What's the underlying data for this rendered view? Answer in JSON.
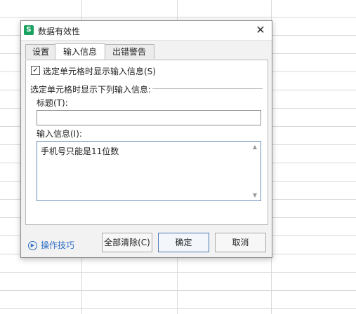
{
  "dialog": {
    "title": "数据有效性",
    "app_icon": "S",
    "close_glyph": "✕"
  },
  "tabs": [
    {
      "label": "设置"
    },
    {
      "label": "输入信息"
    },
    {
      "label": "出错警告"
    }
  ],
  "input_message": {
    "show_checkbox_label": "选定单元格时显示输入信息(S)",
    "show_checked": true,
    "group_label": "选定单元格时显示下列输入信息:",
    "title_label": "标题(T):",
    "title_value": "",
    "message_label": "输入信息(I):",
    "message_value": "手机号只能是11位数"
  },
  "footer": {
    "tips_label": "操作技巧",
    "clear_all_label": "全部清除(C)",
    "ok_label": "确定",
    "cancel_label": "取消"
  },
  "icons": {
    "checkbox": "check-icon",
    "tips": "play-circle-icon",
    "close": "close-icon",
    "scroll_up": "triangle-up-icon",
    "scroll_down": "triangle-down-icon"
  }
}
